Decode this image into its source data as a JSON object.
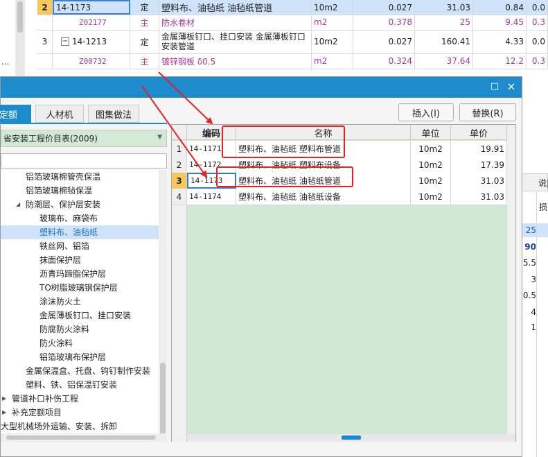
{
  "background_grid": {
    "rows": [
      {
        "seq": "2",
        "code": "14-1173",
        "type": "定",
        "name": "塑料布、油毡纸 油毡纸管道",
        "unit": "10m2",
        "qty": "0.027",
        "price": "31.03",
        "total": "0.84",
        "extra": "0.0"
      },
      {
        "seq": "",
        "code": "Z02177",
        "type": "主",
        "name": "防水卷材",
        "unit": "m2",
        "qty": "0.378",
        "price": "25",
        "total": "9.45",
        "extra": "0.3"
      },
      {
        "seq": "3",
        "code": "14-1213",
        "type": "定",
        "name": "金属薄板钉口、挂口安装 金属薄板钉口安装管道",
        "unit": "10m2",
        "qty": "0.027",
        "price": "160.41",
        "total": "4.33",
        "extra": "0.0"
      },
      {
        "seq": "",
        "code": "Z00732",
        "type": "主",
        "name": "镀锌钢板 δ0.5",
        "unit": "m2",
        "qty": "0.324",
        "price": "37.64",
        "total": "12.2",
        "extra": "0.3"
      }
    ],
    "collapse_symbol": "−",
    "dot": "..."
  },
  "right_panel": {
    "tab_label": "说|",
    "col_header": "损",
    "values": [
      "25",
      "90",
      "5.5",
      "3",
      "0.5",
      "4",
      "1"
    ]
  },
  "dialog": {
    "maximize_icon": "□",
    "close_icon": "×",
    "tabs": [
      {
        "label": "定额"
      },
      {
        "label": "人材机"
      },
      {
        "label": "图集做法"
      }
    ],
    "insert_label": "插入(I)",
    "replace_label": "替换(R)",
    "library": "省安装工程价目表(2009)",
    "tree": [
      {
        "label": "铝箔玻璃棉管壳保温",
        "indent": 36
      },
      {
        "label": "铝箔玻璃棉毡保温",
        "indent": 36
      },
      {
        "label": "防潮层、保护层安装",
        "indent": 36,
        "expanded": true
      },
      {
        "label": "玻璃布、麻袋布",
        "indent": 56
      },
      {
        "label": "塑料布、油毡纸",
        "indent": 56,
        "selected": true
      },
      {
        "label": "铁丝网、铝箔",
        "indent": 56
      },
      {
        "label": "抹面保护层",
        "indent": 56
      },
      {
        "label": "沥青玛蹄脂保护层",
        "indent": 56
      },
      {
        "label": "TO树脂玻璃钢保护层",
        "indent": 56
      },
      {
        "label": "涂沫防火土",
        "indent": 56
      },
      {
        "label": "金属薄板钉口、挂口安装",
        "indent": 56
      },
      {
        "label": "防腐防火涂料",
        "indent": 56
      },
      {
        "label": "防火涂料",
        "indent": 56
      },
      {
        "label": "铝箔玻璃布保护层",
        "indent": 56
      },
      {
        "label": "金属保温盒、托盘、钩钉制作安装",
        "indent": 36
      },
      {
        "label": "塑料、铁、铝保温钉安装",
        "indent": 36
      },
      {
        "label": "管道补口补伤工程",
        "indent": 16,
        "collapsed": true
      },
      {
        "label": "补充定额项目",
        "indent": 16,
        "collapsed": true
      },
      {
        "label": "大型机械场外运输、安装、拆卸",
        "indent": 0
      }
    ],
    "grid": {
      "headers": {
        "code": "编码",
        "name": "名称",
        "unit": "单位",
        "price": "单价"
      },
      "rows": [
        {
          "num": "1",
          "code": "14-1171",
          "name": "塑料布、油毡纸 塑料布管道",
          "unit": "10m2",
          "price": "19.91"
        },
        {
          "num": "2",
          "code": "14-1172",
          "name": "塑料布、油毡纸 塑料布设备",
          "unit": "10m2",
          "price": "17.39"
        },
        {
          "num": "3",
          "code": "14-1173",
          "name": "塑料布、油毡纸 油毡纸管道",
          "unit": "10m2",
          "price": "31.03",
          "selected": true
        },
        {
          "num": "4",
          "code": "14-1174",
          "name": "塑料布、油毡纸 油毡纸设备",
          "unit": "10m2",
          "price": "31.03"
        }
      ]
    }
  },
  "colors": {
    "accent": "#1e8ccc",
    "annotation": "#e82020",
    "tree_bg": "#d3ead7",
    "grid_bg": "#cfe8d4",
    "purple": "#a0399b"
  }
}
